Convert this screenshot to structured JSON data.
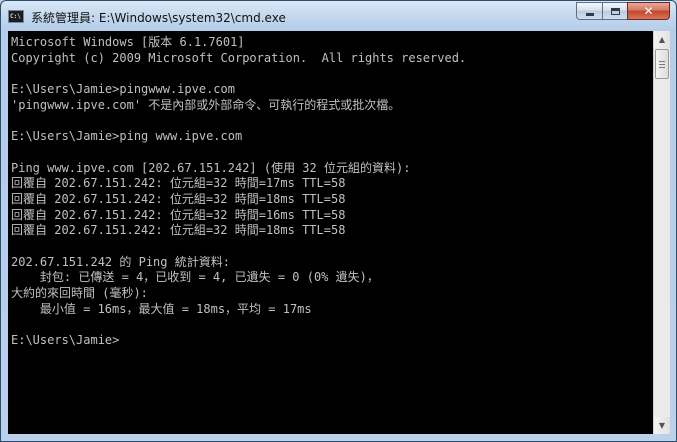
{
  "window": {
    "title": "系統管理員: E:\\Windows\\system32\\cmd.exe",
    "icon": "cmd-icon",
    "icon_label": "C:\\",
    "minimize_icon": "minimize-icon",
    "maximize_icon": "maximize-icon",
    "close_icon": "close-icon",
    "close_glyph": "✕"
  },
  "console": {
    "background": "#000000",
    "foreground": "#c0c0c0",
    "lines": [
      "Microsoft Windows [版本 6.1.7601]",
      "Copyright (c) 2009 Microsoft Corporation.  All rights reserved.",
      "",
      "E:\\Users\\Jamie>pingwww.ipve.com",
      "'pingwww.ipve.com' 不是內部或外部命令、可執行的程式或批次檔。",
      "",
      "E:\\Users\\Jamie>ping www.ipve.com",
      "",
      "Ping www.ipve.com [202.67.151.242] (使用 32 位元組的資料):",
      "回覆自 202.67.151.242: 位元組=32 時間=17ms TTL=58",
      "回覆自 202.67.151.242: 位元組=32 時間=18ms TTL=58",
      "回覆自 202.67.151.242: 位元組=32 時間=16ms TTL=58",
      "回覆自 202.67.151.242: 位元組=32 時間=18ms TTL=58",
      "",
      "202.67.151.242 的 Ping 統計資料:",
      "    封包: 已傳送 = 4，已收到 = 4, 已遺失 = 0 (0% 遺失)，",
      "大約的來回時間 (毫秒):",
      "    最小值 = 16ms，最大值 = 18ms，平均 = 17ms",
      "",
      "E:\\Users\\Jamie>"
    ]
  },
  "scrollbar": {
    "up_icon": "scroll-up-arrow-icon",
    "down_icon": "scroll-down-arrow-icon",
    "up_glyph": "▲",
    "down_glyph": "▼"
  }
}
